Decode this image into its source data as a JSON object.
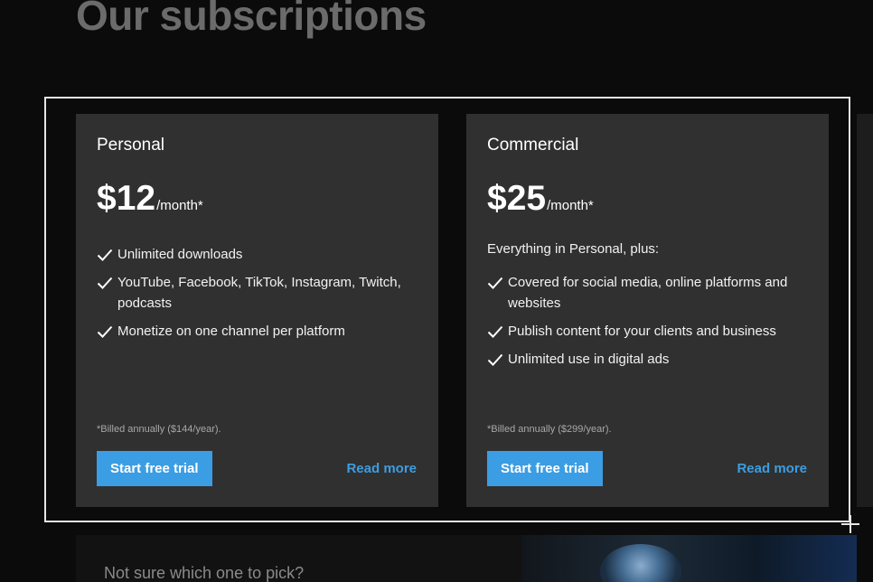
{
  "page": {
    "title": "Our subscriptions"
  },
  "plans": [
    {
      "name": "Personal",
      "price": "$12",
      "period": "/month*",
      "intro": "",
      "features": [
        "Unlimited downloads",
        "YouTube, Facebook, TikTok, Instagram, Twitch, podcasts",
        "Monetize on one channel per platform"
      ],
      "billing": "*Billed annually ($144/year).",
      "cta_label": "Start free trial",
      "read_more_label": "Read more"
    },
    {
      "name": "Commercial",
      "price": "$25",
      "period": "/month*",
      "intro": "Everything in Personal, plus:",
      "features": [
        "Covered for social media, online platforms and websites",
        "Publish content for your clients and business",
        "Unlimited use in digital ads"
      ],
      "billing": "*Billed annually ($299/year).",
      "cta_label": "Start free trial",
      "read_more_label": "Read more"
    }
  ],
  "help_banner": {
    "text": "Not sure which one to pick?"
  },
  "icons": {
    "feature_bullet": "checkmark-icon",
    "cursor": "crosshair-cursor-icon"
  },
  "colors": {
    "accent": "#3b9de3",
    "link": "#3d9de0",
    "card_bg": "#303030",
    "page_bg": "#0b0b0b",
    "title_gray": "#6b6b6b"
  }
}
